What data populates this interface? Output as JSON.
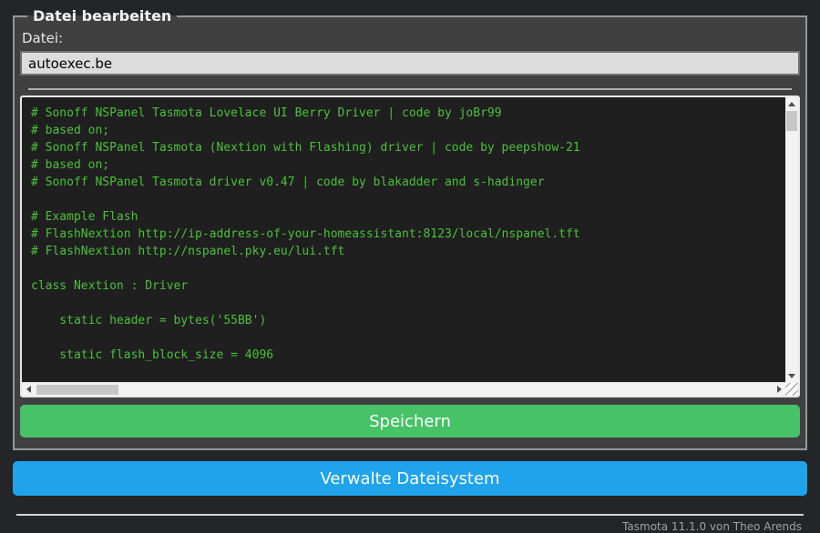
{
  "form": {
    "legend": "Datei bearbeiten",
    "file_label": "Datei:",
    "file_input_value": "autoexec.be",
    "save_button_label": "Speichern"
  },
  "editor": {
    "content": "# Sonoff NSPanel Tasmota Lovelace UI Berry Driver | code by joBr99\n# based on;\n# Sonoff NSPanel Tasmota (Nextion with Flashing) driver | code by peepshow-21\n# based on;\n# Sonoff NSPanel Tasmota driver v0.47 | code by blakadder and s-hadinger\n\n# Example Flash\n# FlashNextion http://ip-address-of-your-homeassistant:8123/local/nspanel.tft\n# FlashNextion http://nspanel.pky.eu/lui.tft\n\nclass Nextion : Driver\n\n    static header = bytes('55BB')\n\n    static flash_block_size = 4096"
  },
  "manage_button_label": "Verwalte Dateisystem",
  "footer": {
    "text": "Tasmota 11.1.0 von Theo Arends"
  },
  "colors": {
    "page_background": "#242526",
    "form_background": "#404040",
    "console_background": "#1f1f1f",
    "console_text": "#4ac139",
    "input_background": "#dcdcdc",
    "save_button": "#47c266",
    "manage_button": "#1fa3ec",
    "text": "#eaeaea",
    "footer_text": "#a0a0a0"
  }
}
